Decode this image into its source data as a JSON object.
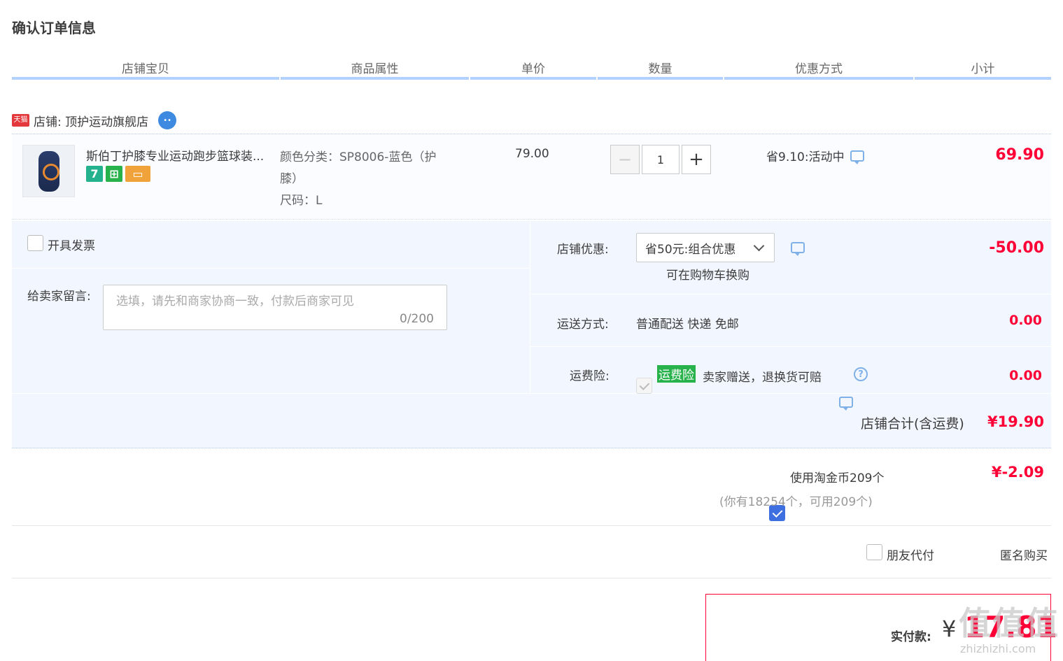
{
  "page": {
    "title": "确认订单信息"
  },
  "headers": [
    "店铺宝贝",
    "商品属性",
    "单价",
    "数量",
    "优惠方式",
    "小计"
  ],
  "shop": {
    "tmall_logo": "天猫",
    "label": "店铺: 顶护运动旗舰店"
  },
  "item": {
    "name": "斯伯丁护膝专业运动跑步篮球装...",
    "badge_7": "7",
    "attr_color": "颜色分类：SP8006-蓝色（护",
    "attr_color_cont": "膝）",
    "attr_size": "尺码：L",
    "price": "79.00",
    "qty_minus": "−",
    "qty": "1",
    "qty_plus": "+",
    "promo": "省9.10:活动中",
    "subtotal": "69.90"
  },
  "invoice": {
    "label": "开具发票"
  },
  "message": {
    "label": "给卖家留言:",
    "placeholder": "选填，请先和商家协商一致，付款后商家可见",
    "count": "0/200"
  },
  "shop_coupon": {
    "label": "店铺优惠:",
    "selected": "省50元:组合优惠",
    "note": "可在购物车换购",
    "amount": "-50.00"
  },
  "shipping": {
    "label": "运送方式:",
    "value": "普通配送 快递 免邮",
    "amount": "0.00"
  },
  "insurance": {
    "label": "运费险:",
    "tag": "运费险",
    "text": "卖家赠送，退换货可赔",
    "help": "?",
    "amount": "0.00"
  },
  "shop_total": {
    "label": "店铺合计(含运费)",
    "amount": "¥19.90"
  },
  "coins": {
    "label": "使用淘金币209个",
    "note": "(你有18254个，可用209个)",
    "amount": "¥-2.09"
  },
  "options": {
    "friend_pay": "朋友代付",
    "anonymous": "匿名购买"
  },
  "pay": {
    "label": "实付款:",
    "currency": "¥",
    "amount": "17.81"
  },
  "watermark": {
    "main": "值值值",
    "sub": "zhizhizhi.com"
  },
  "colors": {
    "accent_red": "#ff0036",
    "header_line": "#b2d1ff",
    "panel_bg": "#f2f7ff",
    "check_blue": "#3d6fe0",
    "insurance_green": "#27b24b"
  }
}
